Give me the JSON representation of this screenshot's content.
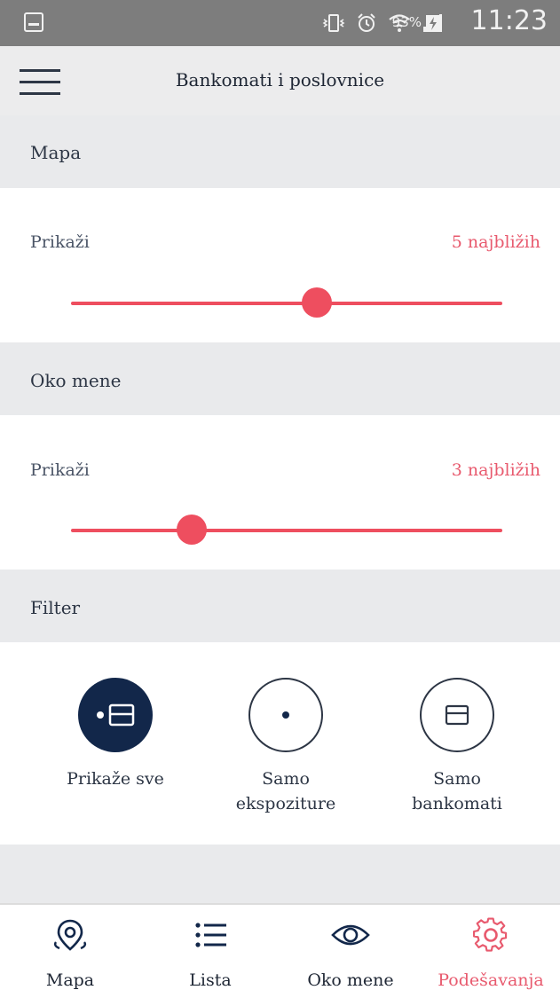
{
  "status_bar": {
    "battery": "93%",
    "time": "11:23"
  },
  "header": {
    "title": "Bankomati i poslovnice"
  },
  "sections": {
    "mapa": {
      "title": "Mapa",
      "label": "Prikaži",
      "value": "5 najbližih",
      "slider_level": 0.57
    },
    "oko_mene": {
      "title": "Oko mene",
      "label": "Prikaži",
      "value": "3 najbližih",
      "slider_level": 0.28
    },
    "filter": {
      "title": "Filter",
      "options": [
        {
          "label": "Prikaže sve",
          "selected": true,
          "icon": "atm-and-branch-icon"
        },
        {
          "label": "Samo\nekspoziture",
          "selected": false,
          "icon": "branch-dot-icon"
        },
        {
          "label": "Samo\nbankomati",
          "selected": false,
          "icon": "card-icon"
        }
      ]
    }
  },
  "bottom_nav": {
    "items": [
      {
        "label": "Mapa",
        "icon": "map-pin-icon"
      },
      {
        "label": "Lista",
        "icon": "list-icon"
      },
      {
        "label": "Oko mene",
        "icon": "eye-icon"
      },
      {
        "label": "Podešavanja",
        "icon": "gear-icon",
        "active": true
      }
    ]
  },
  "colors": {
    "accent": "#ee4e5f",
    "accent_text": "#e85a6e",
    "dark": "#12274a",
    "section_bg": "#e9eaec"
  }
}
